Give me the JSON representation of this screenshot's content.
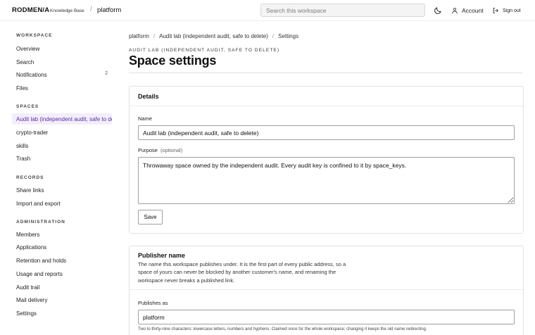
{
  "header": {
    "brand": "RODMEN/A",
    "brand_sub": "Knowledge Base",
    "separator": "/",
    "workspace": "platform",
    "search_placeholder": "Search this workspace",
    "account_label": "Account",
    "signout_label": "Sign out"
  },
  "sidebar": {
    "workspace_heading": "WORKSPACE",
    "workspace_items": [
      {
        "label": "Overview"
      },
      {
        "label": "Search"
      },
      {
        "label": "Notifications",
        "count": "2"
      },
      {
        "label": "Files"
      }
    ],
    "spaces_heading": "SPACES",
    "spaces_items": [
      {
        "label": "Audit lab (independent audit, safe to delete)",
        "active": true
      },
      {
        "label": "crypto-trader"
      },
      {
        "label": "skills"
      },
      {
        "label": "Trash"
      }
    ],
    "records_heading": "RECORDS",
    "records_items": [
      {
        "label": "Share links"
      },
      {
        "label": "Import and export"
      }
    ],
    "admin_heading": "ADMINISTRATION",
    "admin_items": [
      {
        "label": "Members"
      },
      {
        "label": "Applications"
      },
      {
        "label": "Retention and holds"
      },
      {
        "label": "Usage and reports"
      },
      {
        "label": "Audit trail"
      },
      {
        "label": "Mail delivery"
      },
      {
        "label": "Settings"
      }
    ]
  },
  "breadcrumb": [
    "platform",
    "Audit lab (independent audit, safe to delete)",
    "Settings"
  ],
  "breadcrumb_sep": "/",
  "eyebrow": "AUDIT LAB (INDEPENDENT AUDIT, SAFE TO DELETE)",
  "title": "Space settings",
  "details": {
    "heading": "Details",
    "name_label": "Name",
    "name_value": "Audit lab (independent audit, safe to delete)",
    "purpose_label": "Purpose",
    "purpose_optional": "(optional)",
    "purpose_value": "Throwaway space owned by the independent audit. Every audit key is confined to it by space_keys.",
    "save_label": "Save"
  },
  "publisher": {
    "heading": "Publisher name",
    "description": "The name this workspace publishes under. It is the first part of every public address, so a space of yours can never be blocked by another customer's name, and renaming the workspace never breaks a published link.",
    "publishes_label": "Publishes as",
    "publishes_value": "platform",
    "hint": "Two to thirty-nine characters: lowercase letters, numbers and hyphens. Claimed once for the whole workspace; changing it keeps the old name redirecting."
  },
  "colors": {
    "accent": "#5b2ea6",
    "active_bg": "#f3eefb"
  }
}
